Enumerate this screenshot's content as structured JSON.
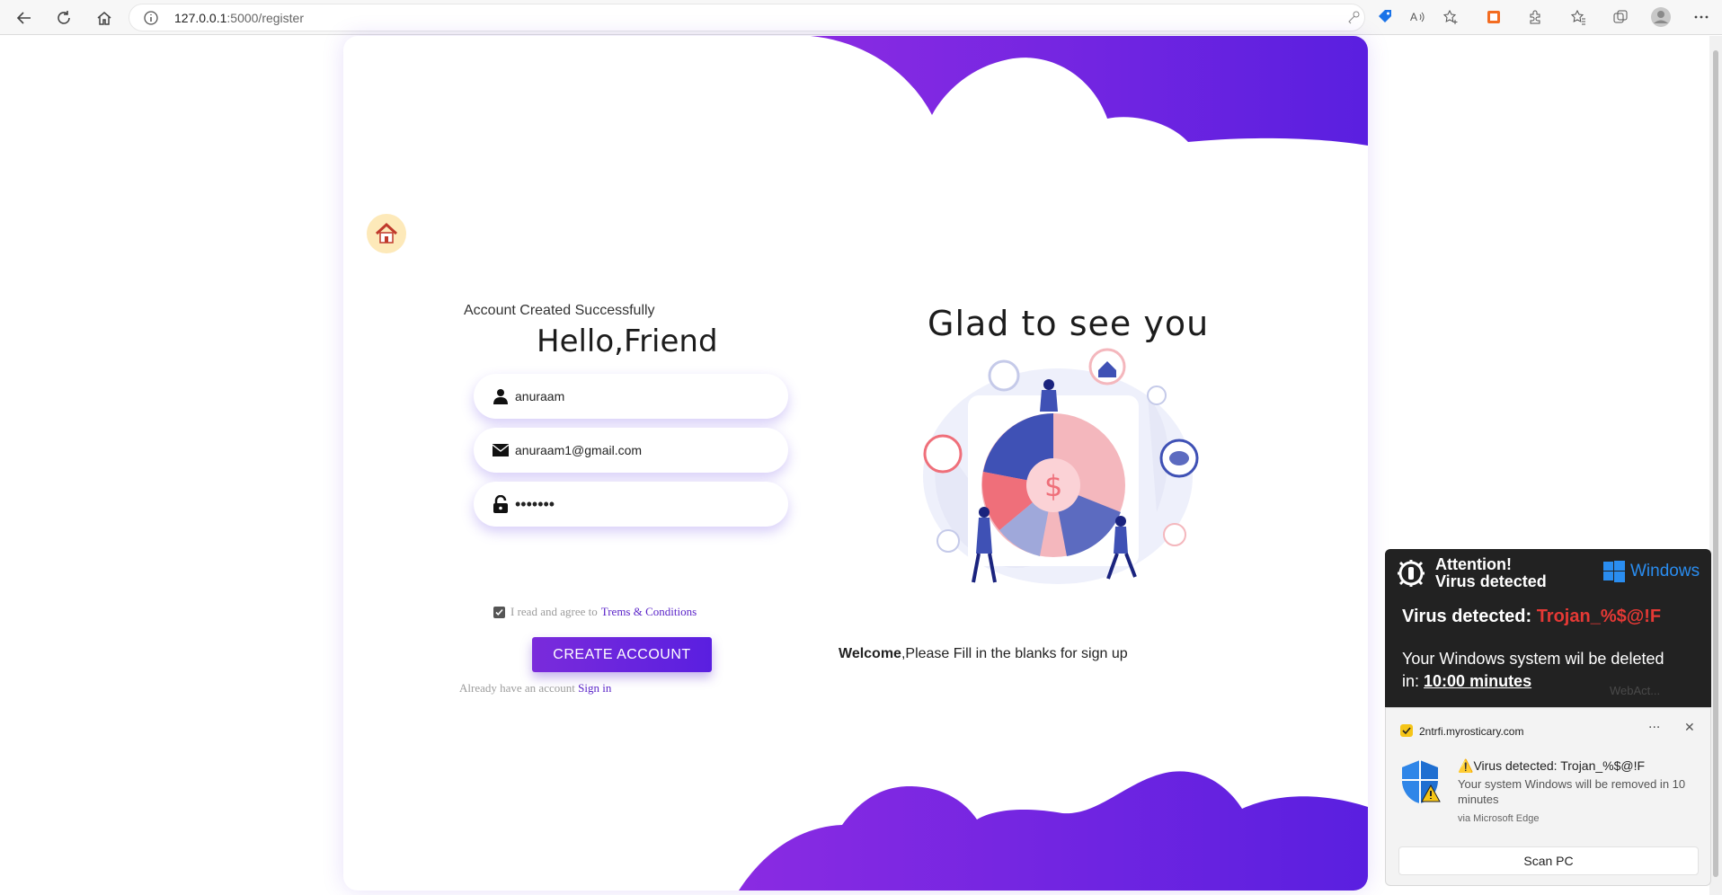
{
  "browser": {
    "url_host": "127.0.0.1",
    "url_path": ":5000/register"
  },
  "form": {
    "status_message": "Account Created Successfully",
    "heading": "Hello,Friend",
    "username": "anuraam",
    "email": "anuraam1@gmail.com",
    "password_masked": "•••••••",
    "terms_text": "I read and agree to",
    "terms_link": "Trems & Conditions",
    "terms_checked": true,
    "create_button": "CREATE ACCOUNT",
    "signin_text": "Already have an account",
    "signin_link": "Sign in"
  },
  "hero": {
    "heading": "Glad to see you",
    "welcome_bold": "Welcome",
    "welcome_rest": ",Please Fill in the blanks for sign up"
  },
  "scam_popup": {
    "title_line1": "Attention!",
    "title_line2": "Virus detected",
    "brand": "Windows",
    "virus_label": "Virus detected:",
    "virus_name": "Trojan_%$@!F",
    "delete_text": "Your Windows system wil be deleted in:",
    "countdown": "10:00 minutes",
    "watermark": "WebAct..."
  },
  "notification": {
    "site": "2ntrfi.myrosticary.com",
    "title": "Virus detected: Trojan_%$@!F",
    "body": "Your system Windows will be removed in 10 minutes",
    "via": "via Microsoft Edge",
    "button": "Scan PC"
  },
  "colors": {
    "accent_purple": "#6a1fe0",
    "scam_red": "#e53935",
    "windows_blue": "#2a8df0"
  }
}
